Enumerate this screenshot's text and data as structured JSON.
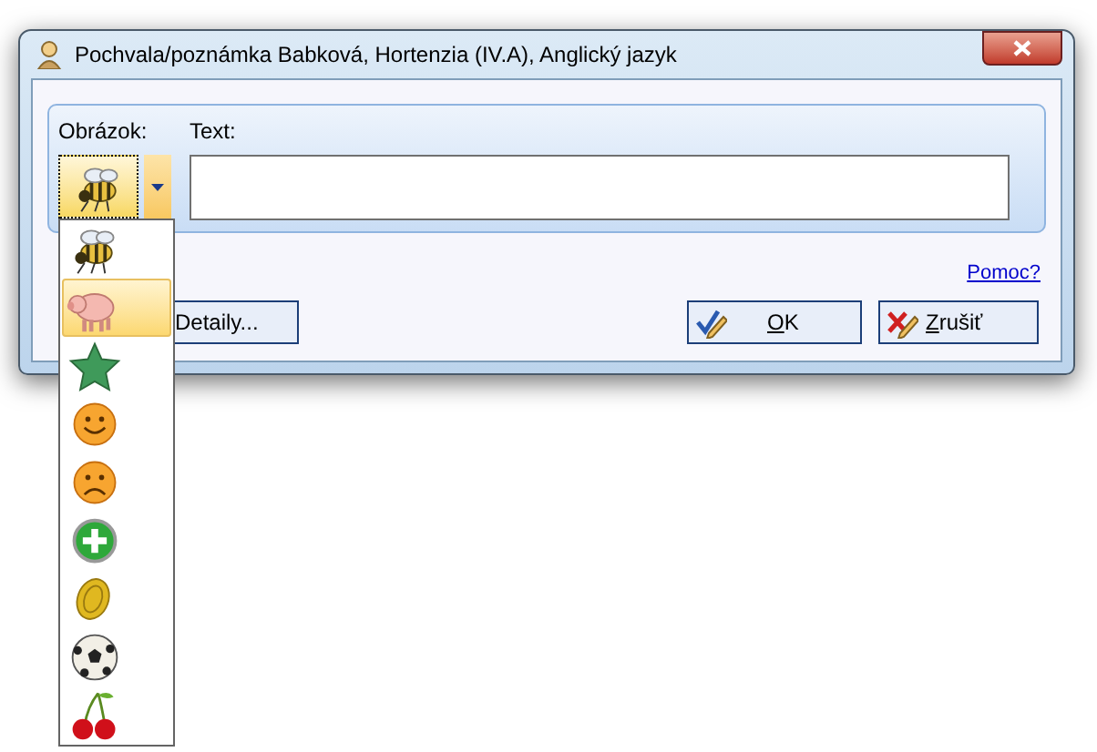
{
  "window": {
    "title": "Pochvala/poznámka Babková, Hortenzia (IV.A), Anglický jazyk"
  },
  "picture_label": "Obrázok:",
  "text_label": "Text:",
  "picture_combo": {
    "kind": "bee",
    "expanded": true
  },
  "picture_options": [
    {
      "kind": "bee",
      "highlighted": false
    },
    {
      "kind": "pig",
      "highlighted": true
    },
    {
      "kind": "star",
      "highlighted": false
    },
    {
      "kind": "smile",
      "highlighted": false
    },
    {
      "kind": "sad",
      "highlighted": false
    },
    {
      "kind": "plus",
      "highlighted": false
    },
    {
      "kind": "coin",
      "highlighted": false
    },
    {
      "kind": "ball",
      "highlighted": false
    },
    {
      "kind": "cherries",
      "highlighted": false
    }
  ],
  "help_link": "Pomoc?",
  "buttons": [
    {
      "kind": "details",
      "label": "Detaily...",
      "underline_first": false
    },
    {
      "kind": "ok",
      "label": "OK",
      "underline_first": true
    },
    {
      "kind": "cancel",
      "label": "Zrušiť",
      "underline_first": true
    }
  ]
}
